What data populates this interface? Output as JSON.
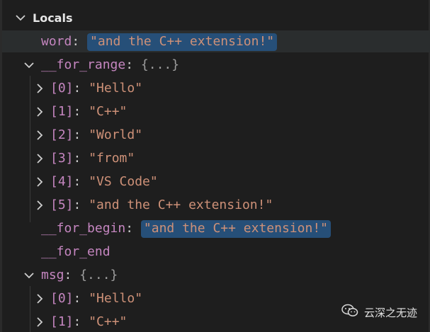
{
  "locals": {
    "title": "Locals",
    "rows": [
      {
        "id": "word",
        "name": "word",
        "sep": ": ",
        "value": "\"and the C++ extension!\"",
        "pill": true
      },
      {
        "id": "for_range",
        "name": "__for_range",
        "sep": ": ",
        "value": "{...}"
      },
      {
        "id": "r0",
        "name": "[0]",
        "sep": ": ",
        "value": "\"Hello\""
      },
      {
        "id": "r1",
        "name": "[1]",
        "sep": ": ",
        "value": "\"C++\""
      },
      {
        "id": "r2",
        "name": "[2]",
        "sep": ": ",
        "value": "\"World\""
      },
      {
        "id": "r3",
        "name": "[3]",
        "sep": ": ",
        "value": "\"from\""
      },
      {
        "id": "r4",
        "name": "[4]",
        "sep": ": ",
        "value": "\"VS Code\""
      },
      {
        "id": "r5",
        "name": "[5]",
        "sep": ": ",
        "value": "\"and the C++ extension!\""
      },
      {
        "id": "for_begin",
        "name": "__for_begin",
        "sep": ": ",
        "value": "\"and the C++ extension!\"",
        "pill": true
      },
      {
        "id": "for_end",
        "name": "__for_end",
        "sep": "",
        "value": ""
      },
      {
        "id": "msg",
        "name": "msg",
        "sep": ": ",
        "value": "{...}"
      },
      {
        "id": "m0",
        "name": "[0]",
        "sep": ": ",
        "value": "\"Hello\""
      },
      {
        "id": "m1",
        "name": "[1]",
        "sep": ": ",
        "value": "\"C++\""
      }
    ]
  },
  "watermark": {
    "text": "云深之无迹",
    "icon": "wechat-icon"
  }
}
